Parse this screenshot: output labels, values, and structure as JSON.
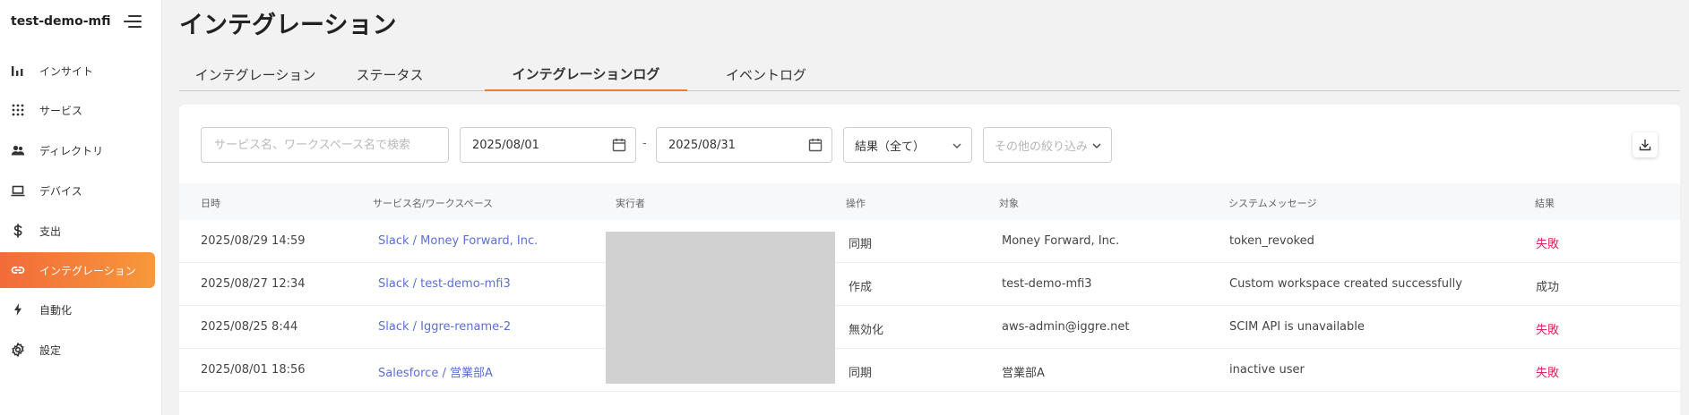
{
  "sidebar": {
    "brand": "test-demo-mfi",
    "items": [
      {
        "label": "インサイト",
        "icon": "bar-chart-icon"
      },
      {
        "label": "サービス",
        "icon": "grid-icon"
      },
      {
        "label": "ディレクトリ",
        "icon": "users-icon"
      },
      {
        "label": "デバイス",
        "icon": "laptop-icon"
      },
      {
        "label": "支出",
        "icon": "dollar-icon"
      },
      {
        "label": "インテグレーション",
        "icon": "link-icon",
        "active": true
      },
      {
        "label": "自動化",
        "icon": "lightning-icon"
      },
      {
        "label": "設定",
        "icon": "gear-icon"
      }
    ]
  },
  "header": {
    "title": "インテグレーション"
  },
  "tabs": [
    {
      "label": "インテグレーション"
    },
    {
      "label": "ステータス"
    },
    {
      "label": "インテグレーションログ",
      "active": true
    },
    {
      "label": "イベントログ"
    }
  ],
  "filters": {
    "search_placeholder": "サービス名、ワークスペース名で検索",
    "date_from": "2025/08/01",
    "date_separator": "-",
    "date_to": "2025/08/31",
    "result_select": "結果（全て）",
    "other_filter": "その他の絞り込み"
  },
  "table": {
    "columns": [
      "日時",
      "サービス名/ワークスペース",
      "実行者",
      "操作",
      "対象",
      "システムメッセージ",
      "結果"
    ],
    "rows": [
      {
        "datetime": "2025/08/29 14:59",
        "service": "Slack / Money Forward, Inc.",
        "action": "同期",
        "target": "Money Forward, Inc.",
        "message": "token_revoked",
        "result": "失敗",
        "status": "fail"
      },
      {
        "datetime": "2025/08/27 12:34",
        "service": "Slack / test-demo-mfi3",
        "action": "作成",
        "target": "test-demo-mfi3",
        "message": "Custom workspace created successfully",
        "result": "成功",
        "status": "ok"
      },
      {
        "datetime": "2025/08/25 8:44",
        "service": "Slack / Iggre-rename-2",
        "action": "無効化",
        "target": "aws-admin@iggre.net",
        "message": "SCIM API is unavailable",
        "result": "失敗",
        "status": "fail"
      },
      {
        "datetime": "2025/08/01 18:56",
        "service": "Salesforce / 営業部A",
        "action": "同期",
        "target": "営業部A",
        "message": "inactive user",
        "result": "失敗",
        "status": "fail"
      }
    ]
  },
  "colors": {
    "accent_start": "#f26b3a",
    "accent_end": "#f7983a",
    "link": "#5a6fd6",
    "fail": "#e0245e"
  }
}
